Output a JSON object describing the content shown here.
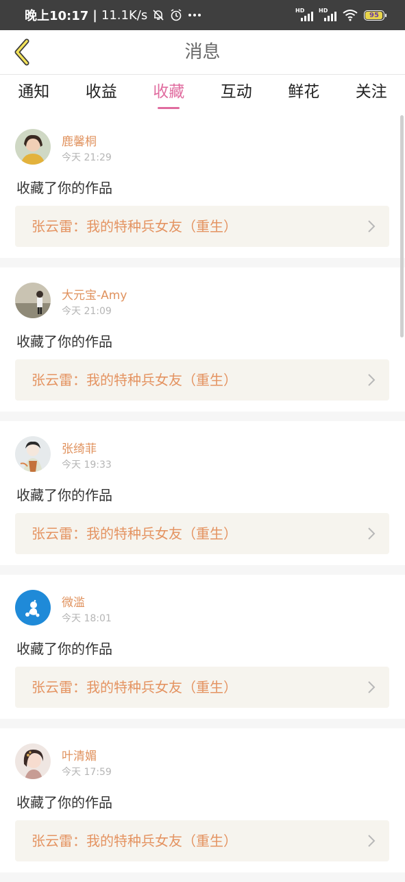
{
  "status_bar": {
    "time": "晚上10:17",
    "net_speed": "11.1K/s",
    "battery": "95",
    "battery_level": 0.95,
    "icons": [
      "mute-bell-icon",
      "alarm-icon",
      "more-dots-icon",
      "signal-hd-icon",
      "signal-hd-icon",
      "wifi-icon",
      "battery-icon"
    ]
  },
  "header": {
    "title": "消息",
    "back_icon": "chevron-left-icon"
  },
  "tabs": [
    {
      "label": "通知"
    },
    {
      "label": "收益"
    },
    {
      "label": "收藏",
      "active": true
    },
    {
      "label": "互动"
    },
    {
      "label": "鲜花"
    },
    {
      "label": "关注"
    }
  ],
  "items": [
    {
      "user": "鹿馨桐",
      "time": "今天 21:29",
      "action": "收藏了你的作品",
      "work": "张云雷：我的特种兵女友（重生）"
    },
    {
      "user": "大元宝-Amy",
      "time": "今天 21:09",
      "action": "收藏了你的作品",
      "work": "张云雷：我的特种兵女友（重生）"
    },
    {
      "user": "张绮菲",
      "time": "今天 19:33",
      "action": "收藏了你的作品",
      "work": "张云雷：我的特种兵女友（重生）"
    },
    {
      "user": "微滥",
      "time": "今天 18:01",
      "action": "收藏了你的作品",
      "work": "张云雷：我的特种兵女友（重生）"
    },
    {
      "user": "叶清媚",
      "time": "今天 17:59",
      "action": "收藏了你的作品",
      "work": "张云雷：我的特种兵女友（重生）"
    }
  ],
  "colors": {
    "accent": "#e06c9f",
    "username": "#e0925e",
    "work_title": "#e49361",
    "status_bar_bg": "#3f3f3f"
  }
}
